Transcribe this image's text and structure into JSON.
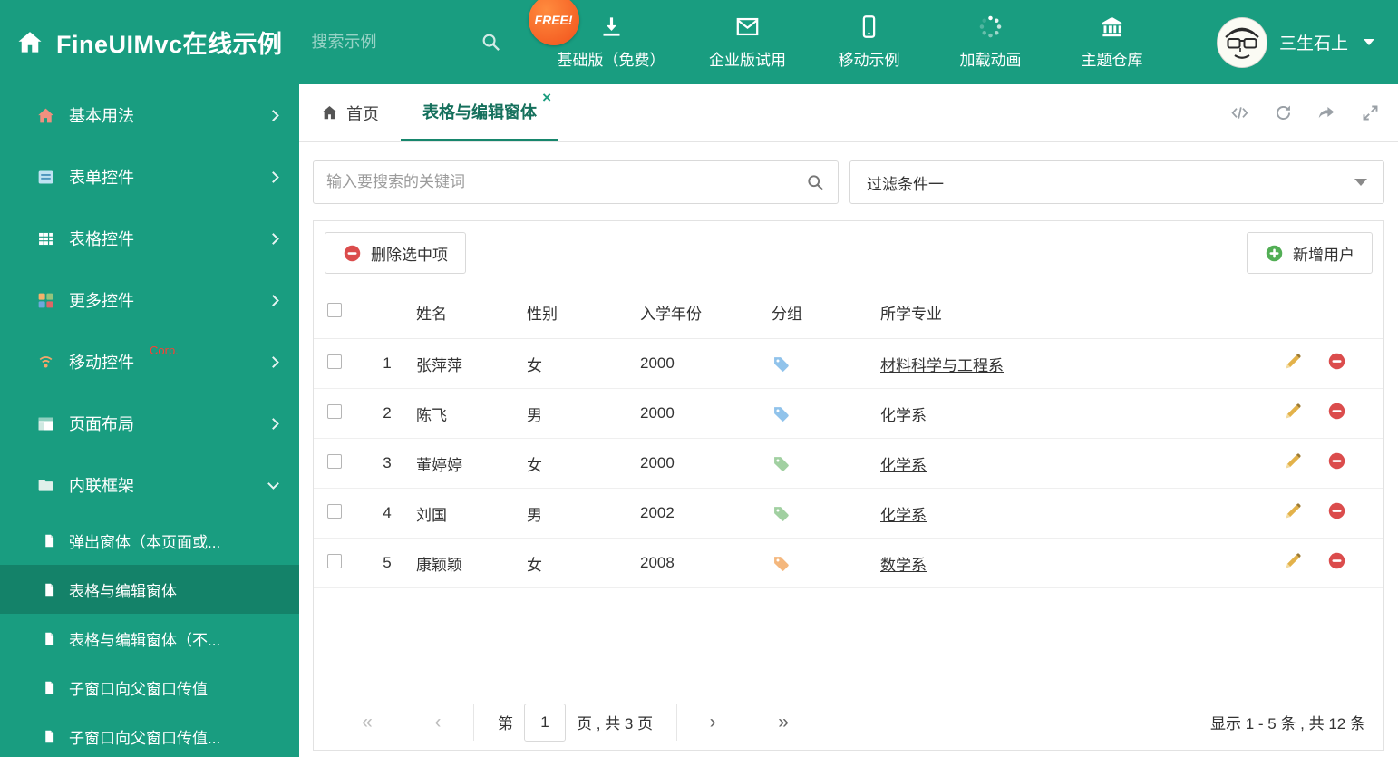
{
  "colors": {
    "header_bg": "#199d80",
    "sidebar_active": "#148269",
    "accent": "#17866c",
    "delete_red": "#db4c4c",
    "add_green": "#52ae55",
    "pencil_gold": "#e3b24a"
  },
  "header": {
    "title": "FineUIMvc在线示例",
    "search_placeholder": "搜索示例",
    "free_badge": "FREE!",
    "nav": [
      {
        "label": "基础版（免费）",
        "icon": "download-icon"
      },
      {
        "label": "企业版试用",
        "icon": "envelope-icon"
      },
      {
        "label": "移动示例",
        "icon": "mobile-icon"
      },
      {
        "label": "加载动画",
        "icon": "spinner-icon"
      },
      {
        "label": "主题仓库",
        "icon": "bank-icon"
      }
    ],
    "user": {
      "name": "三生石上"
    }
  },
  "sidebar": {
    "items": [
      {
        "label": "基本用法"
      },
      {
        "label": "表单控件"
      },
      {
        "label": "表格控件"
      },
      {
        "label": "更多控件"
      },
      {
        "label": "移动控件",
        "badge": "Corp."
      },
      {
        "label": "页面布局"
      },
      {
        "label": "内联框架"
      }
    ],
    "subitems": [
      {
        "label": "弹出窗体（本页面或..."
      },
      {
        "label": "表格与编辑窗体"
      },
      {
        "label": "表格与编辑窗体（不..."
      },
      {
        "label": "子窗口向父窗口传值"
      },
      {
        "label": "子窗口向父窗口传值..."
      }
    ]
  },
  "tabs": [
    {
      "label": "首页"
    },
    {
      "label": "表格与编辑窗体",
      "close": "×"
    }
  ],
  "filters": {
    "search_placeholder": "输入要搜索的关键词",
    "dropdown_value": "过滤条件一"
  },
  "toolbar": {
    "delete_label": "删除选中项",
    "add_label": "新增用户"
  },
  "table": {
    "columns": [
      "姓名",
      "性别",
      "入学年份",
      "分组",
      "所学专业"
    ],
    "rows": [
      {
        "num": "1",
        "name": "张萍萍",
        "gender": "女",
        "year": "2000",
        "tag_color": "#7db8e8",
        "major": "材料科学与工程系"
      },
      {
        "num": "2",
        "name": "陈飞",
        "gender": "男",
        "year": "2000",
        "tag_color": "#7db8e8",
        "major": "化学系"
      },
      {
        "num": "3",
        "name": "董婷婷",
        "gender": "女",
        "year": "2000",
        "tag_color": "#90c890",
        "major": "化学系"
      },
      {
        "num": "4",
        "name": "刘国",
        "gender": "男",
        "year": "2002",
        "tag_color": "#90c890",
        "major": "化学系"
      },
      {
        "num": "5",
        "name": "康颖颖",
        "gender": "女",
        "year": "2008",
        "tag_color": "#f2aa66",
        "major": "数学系"
      }
    ]
  },
  "pagination": {
    "first": "«",
    "prev": "‹",
    "next": "›",
    "last": "»",
    "page_prefix": "第",
    "current_page": "1",
    "page_suffix": "页 , 共 3 页",
    "summary": "显示 1 - 5 条 , 共 12 条"
  }
}
